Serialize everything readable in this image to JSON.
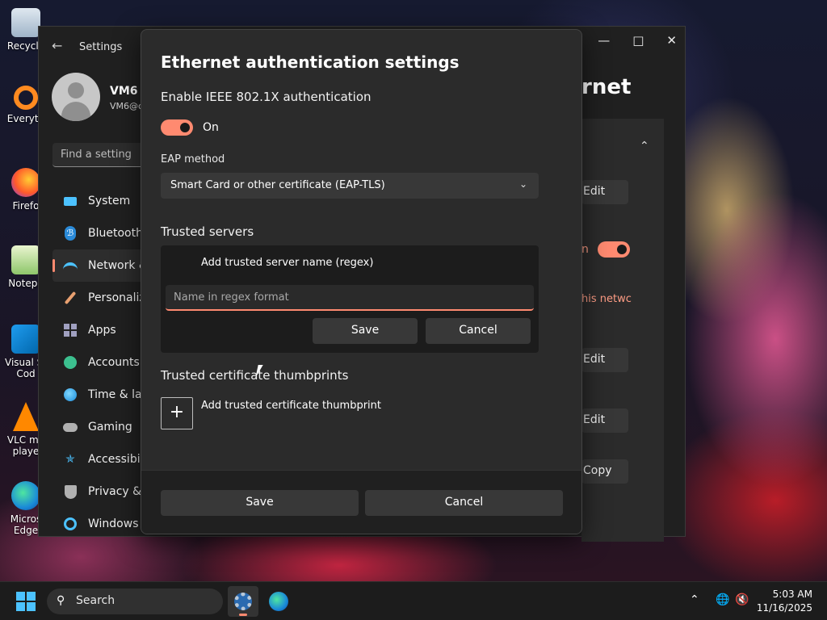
{
  "desktop": {
    "icons": [
      {
        "label": "Recycle"
      },
      {
        "label": "Everyth"
      },
      {
        "label": "Firefo"
      },
      {
        "label": "Notepa"
      },
      {
        "label": "Visual St Cod"
      },
      {
        "label": "VLC me playe"
      },
      {
        "label": "Micros Edge"
      }
    ]
  },
  "settings": {
    "title": "Settings",
    "user_name": "VM6",
    "user_email": "VM6@c",
    "search_placeholder": "Find a setting",
    "nav": [
      {
        "label": "System",
        "icon": "monitor-icon",
        "color": "#4cc2ff"
      },
      {
        "label": "Bluetooth",
        "icon": "bluetooth-icon",
        "color": "#4cc2ff"
      },
      {
        "label": "Network &",
        "icon": "wifi-icon",
        "color": "#4cc2ff"
      },
      {
        "label": "Personaliza",
        "icon": "brush-icon",
        "color": "#e8a070"
      },
      {
        "label": "Apps",
        "icon": "apps-icon",
        "color": "#a0a0c0"
      },
      {
        "label": "Accounts",
        "icon": "person-icon",
        "color": "#3cc08f"
      },
      {
        "label": "Time & lan",
        "icon": "globe-icon",
        "color": "#4cc2ff"
      },
      {
        "label": "Gaming",
        "icon": "gamepad-icon",
        "color": "#b0b0b0"
      },
      {
        "label": "Accessibili",
        "icon": "accessibility-icon",
        "color": "#4cc2ff"
      },
      {
        "label": "Privacy & s",
        "icon": "shield-icon",
        "color": "#b0b0b0"
      },
      {
        "label": "Windows U",
        "icon": "update-icon",
        "color": "#4cc2ff"
      }
    ],
    "background": {
      "heading": "rnet",
      "edit_1": "Edit",
      "edit_2": "Edit",
      "edit_3": "Edit",
      "copy": "Copy",
      "n_text": "n",
      "link_text": "his netwc"
    }
  },
  "dialog": {
    "title": "Ethernet authentication settings",
    "ieee_label": "Enable IEEE 802.1X authentication",
    "toggle_state": "On",
    "eap_label": "EAP method",
    "eap_value": "Smart Card or other certificate (EAP-TLS)",
    "trusted_servers_label": "Trusted servers",
    "add_server_label": "Add trusted server name (regex)",
    "regex_placeholder": "Name in regex format",
    "inner_save": "Save",
    "inner_cancel": "Cancel",
    "thumbprints_label": "Trusted certificate thumbprints",
    "add_thumbprint_label": "Add trusted certificate thumbprint",
    "save": "Save",
    "cancel": "Cancel"
  },
  "taskbar": {
    "search_label": "Search",
    "time": "5:03 AM",
    "date": "11/16/2025"
  },
  "colors": {
    "accent": "#ff8a70",
    "windows_blue": "#4cc2ff"
  }
}
